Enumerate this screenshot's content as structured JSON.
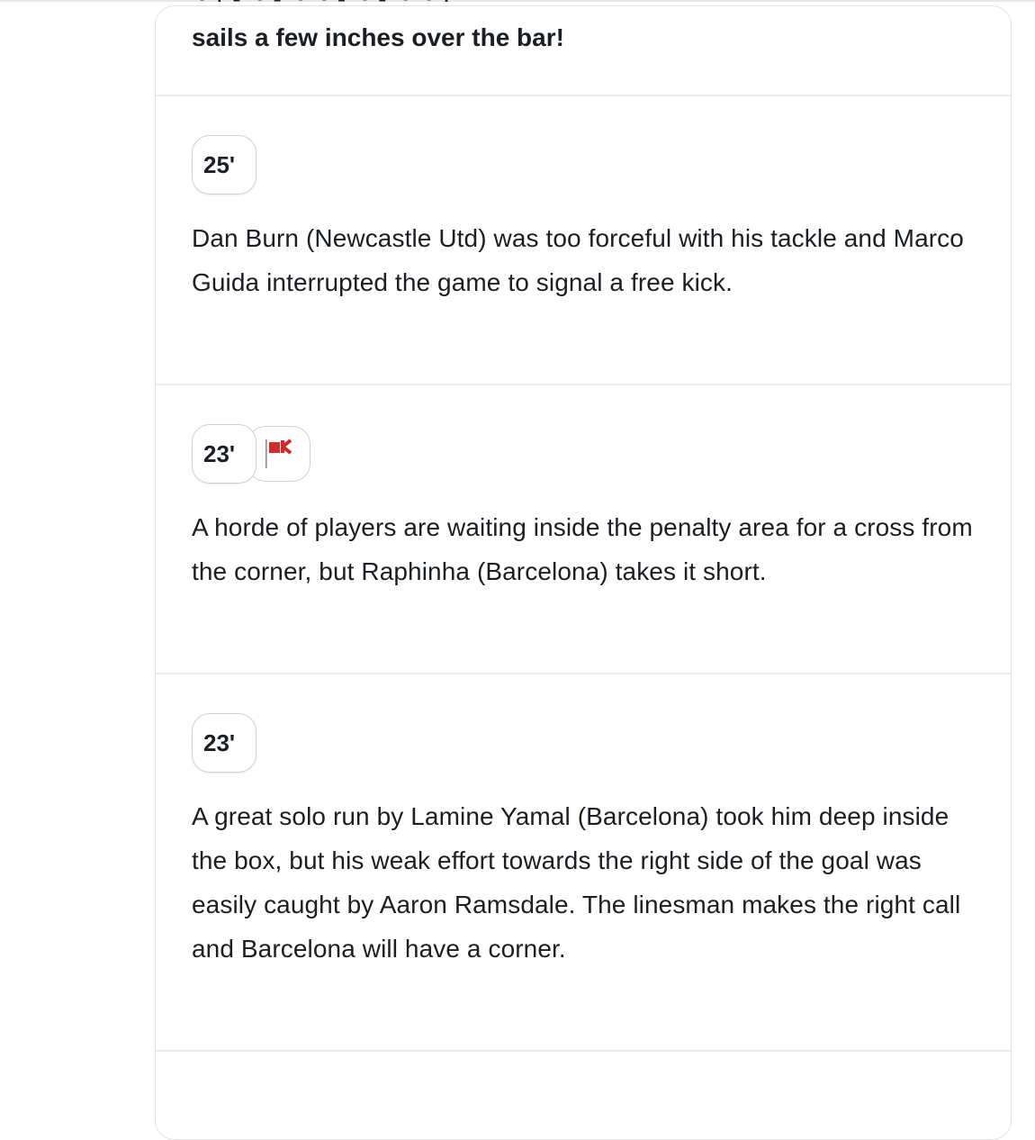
{
  "feed": {
    "clipped_fragment": "~ · - ~ - ~ ~ - ~ - ~ ~ ·",
    "lead_text": "sails a few inches over the bar!",
    "events": [
      {
        "minute": "25'",
        "icon": "",
        "text": "Dan Burn (Newcastle Utd) was too forceful with his tackle and Marco Guida interrupted the game to signal a free kick."
      },
      {
        "minute": "23'",
        "icon": "corner-flag-icon",
        "icon_color": "#d62b2b",
        "text": "A horde of players are waiting inside the penalty area for a cross from the corner, but Raphinha (Barcelona) takes it short."
      },
      {
        "minute": "23'",
        "icon": "",
        "text": "A great solo run by Lamine Yamal (Barcelona) took him deep inside the box, but his weak effort towards the right side of the goal was easily caught by Aaron Ramsdale. The linesman makes the right call and Barcelona will have a corner."
      }
    ]
  }
}
